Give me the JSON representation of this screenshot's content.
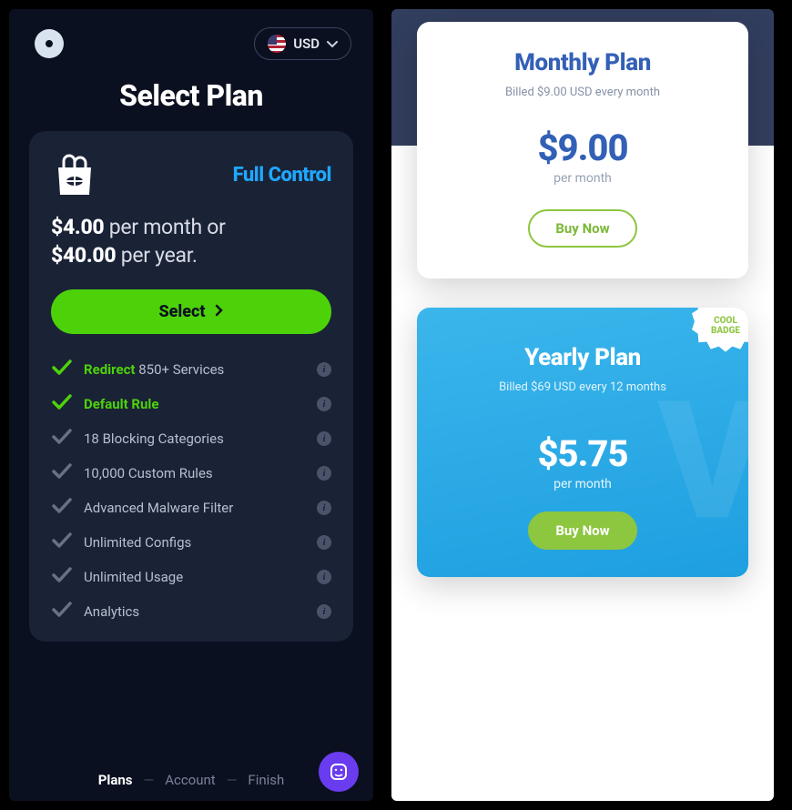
{
  "left": {
    "currency": "USD",
    "title": "Select Plan",
    "plan": {
      "name": "Full Control",
      "price_month": "$4.00",
      "per_month_text": "per month or",
      "price_year": "$40.00",
      "per_year_text": "per year.",
      "select_label": "Select"
    },
    "features": [
      {
        "strong": "Redirect",
        "text": "850+ Services",
        "enabled": true
      },
      {
        "text": "Default Rule",
        "enabled": true
      },
      {
        "text": "18 Blocking Categories",
        "enabled": false
      },
      {
        "text": "10,000 Custom Rules",
        "enabled": false
      },
      {
        "text": "Advanced Malware Filter",
        "enabled": false
      },
      {
        "text": "Unlimited Configs",
        "enabled": false
      },
      {
        "text": "Unlimited Usage",
        "enabled": false
      },
      {
        "text": "Analytics",
        "enabled": false
      }
    ],
    "footer": {
      "steps": [
        "Plans",
        "Account",
        "Finish"
      ],
      "active": 0
    }
  },
  "right": {
    "monthly": {
      "title": "Monthly Plan",
      "subtitle": "Billed $9.00 USD every month",
      "price": "$9.00",
      "per": "per month",
      "buy_label": "Buy Now"
    },
    "yearly": {
      "title": "Yearly Plan",
      "subtitle": "Billed $69 USD every 12 months",
      "price": "$5.75",
      "per": "per month",
      "buy_label": "Buy Now",
      "badge_line1": "COOL",
      "badge_line2": "BADGE"
    }
  }
}
